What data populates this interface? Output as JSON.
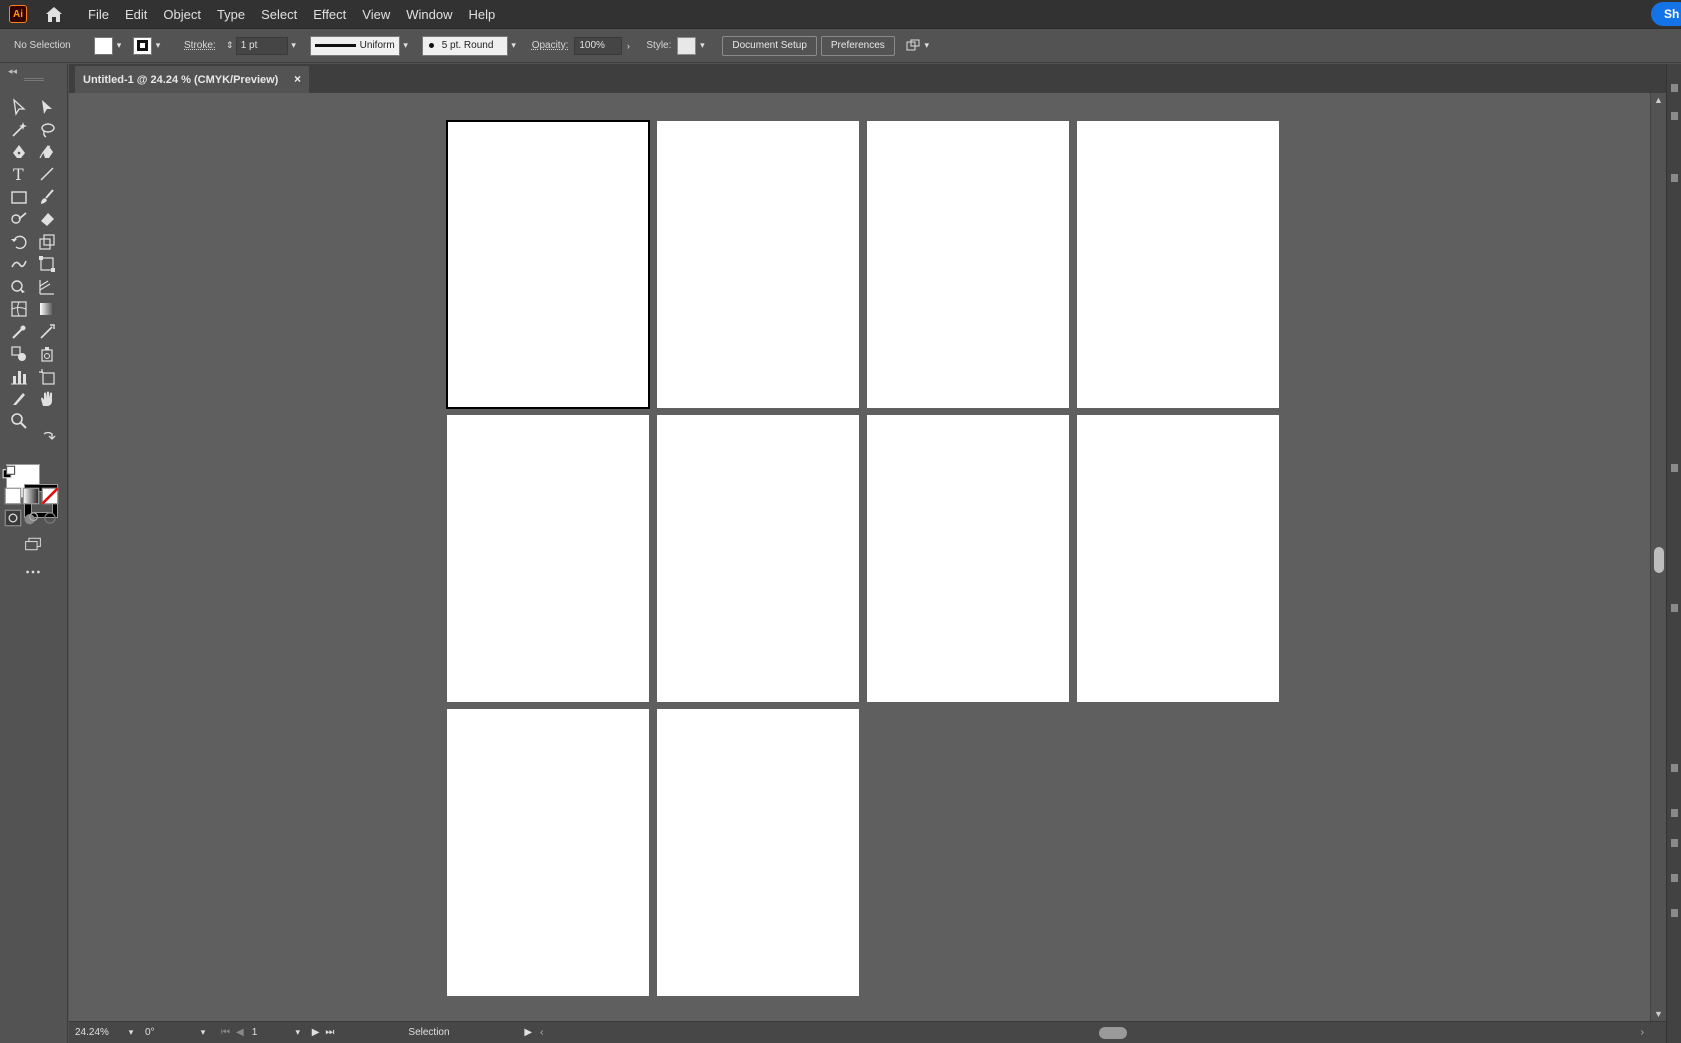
{
  "app": {
    "logo_text": "Ai",
    "colors": {
      "accent": "#ff7f18",
      "share": "#1473e6"
    }
  },
  "menu": [
    "File",
    "Edit",
    "Object",
    "Type",
    "Select",
    "Effect",
    "View",
    "Window",
    "Help"
  ],
  "share_label": "Sh",
  "control": {
    "selection_status": "No Selection",
    "stroke_label": "Stroke:",
    "stroke_weight": "1 pt",
    "profile_label": "Uniform",
    "brush_label": "5 pt. Round",
    "opacity_label": "Opacity:",
    "opacity_value": "100%",
    "style_label": "Style:",
    "document_setup": "Document Setup",
    "preferences": "Preferences"
  },
  "document": {
    "tab_title": "Untitled-1 @ 24.24 % (CMYK/Preview)",
    "close_glyph": "×"
  },
  "artboards": {
    "count": 10,
    "columns": 4,
    "active_index": 0
  },
  "status": {
    "zoom": "24.24%",
    "rotation": "0°",
    "artboard_number": "1",
    "tool_name": "Selection"
  },
  "tools": [
    "selection-tool-icon",
    "direct-selection-tool-icon",
    "magic-wand-tool-icon",
    "lasso-tool-icon",
    "pen-tool-icon",
    "curvature-tool-icon",
    "type-tool-icon",
    "line-segment-tool-icon",
    "rectangle-tool-icon",
    "paintbrush-tool-icon",
    "shaper-tool-icon",
    "eraser-tool-icon",
    "rotate-tool-icon",
    "scale-tool-icon",
    "warp-tool-icon",
    "free-transform-tool-icon",
    "shape-builder-tool-icon",
    "perspective-grid-tool-icon",
    "mesh-tool-icon",
    "gradient-tool-icon",
    "eyedropper-tool-icon",
    "measure-tool-icon",
    "blend-tool-icon",
    "symbol-sprayer-tool-icon",
    "column-graph-tool-icon",
    "artboard-tool-icon",
    "slice-tool-icon",
    "hand-tool-icon",
    "zoom-tool-icon"
  ]
}
